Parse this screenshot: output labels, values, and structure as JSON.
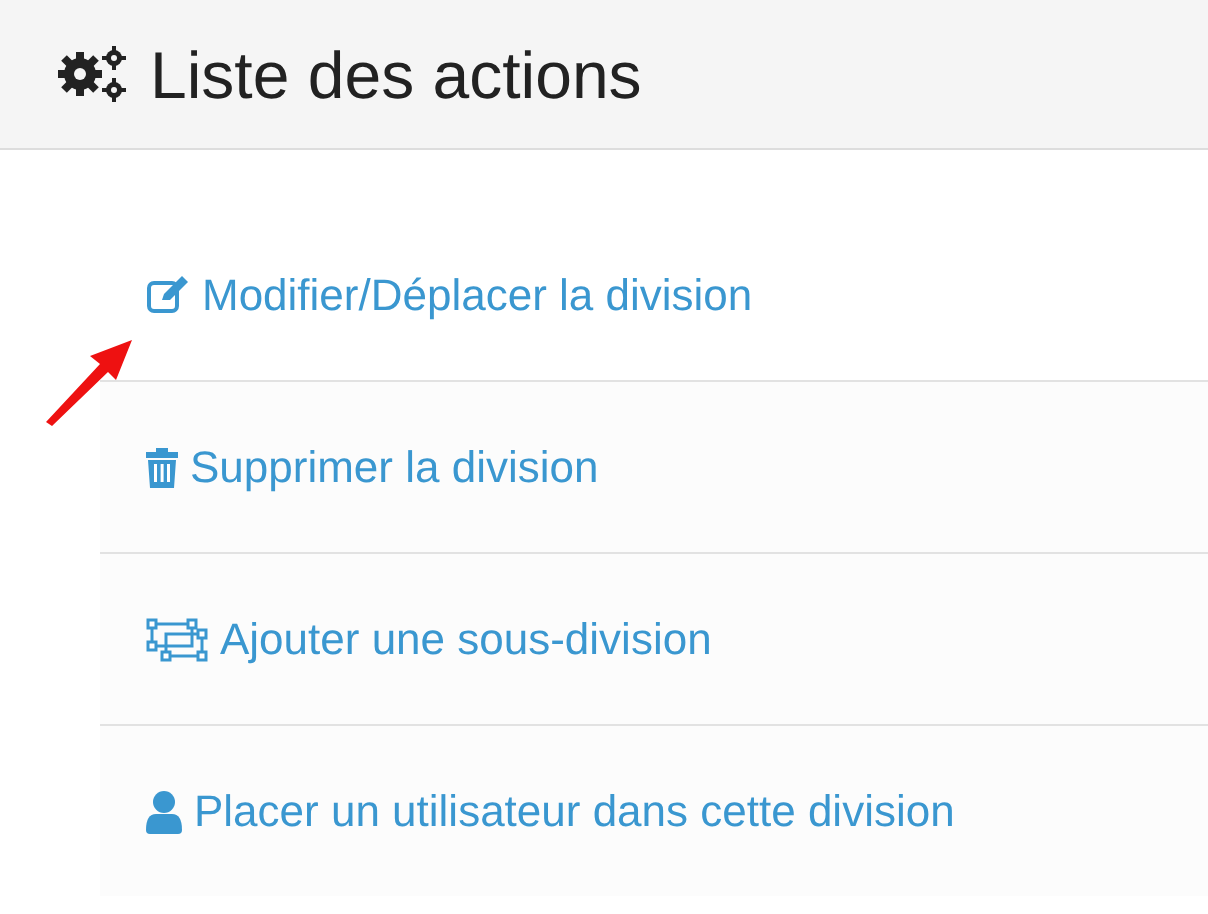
{
  "header": {
    "title": "Liste des actions"
  },
  "actions": [
    {
      "kind": "edit",
      "label": "Modifier/Déplacer la division"
    },
    {
      "kind": "delete",
      "label": "Supprimer la division"
    },
    {
      "kind": "add-child",
      "label": "Ajouter une sous-division"
    },
    {
      "kind": "user",
      "label": "Placer un utilisateur dans cette division"
    }
  ]
}
